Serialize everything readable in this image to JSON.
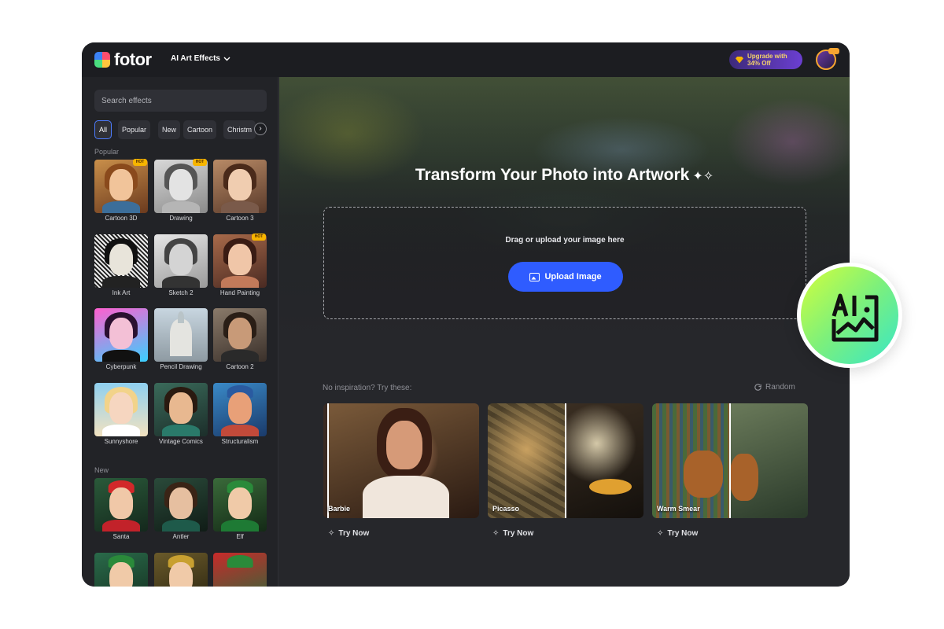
{
  "header": {
    "logo_text": "fotor",
    "menu_label": "AI Art Effects",
    "upgrade_label": "Upgrade with 34% Off"
  },
  "sidebar": {
    "search_placeholder": "Search effects",
    "filters": [
      "All",
      "Popular",
      "New",
      "Cartoon",
      "Christm"
    ],
    "popular_title": "Popular",
    "new_title": "New",
    "hot_label": "HOT",
    "popular_effects": [
      {
        "name": "Cartoon 3D",
        "hot": true
      },
      {
        "name": "Drawing",
        "hot": true
      },
      {
        "name": "Cartoon 3",
        "hot": false
      },
      {
        "name": "Ink Art",
        "hot": false
      },
      {
        "name": "Sketch 2",
        "hot": false
      },
      {
        "name": "Hand Painting",
        "hot": true
      },
      {
        "name": "Cyberpunk",
        "hot": false
      },
      {
        "name": "Pencil Drawing",
        "hot": false
      },
      {
        "name": "Cartoon 2",
        "hot": false
      },
      {
        "name": "Sunnyshore",
        "hot": false
      },
      {
        "name": "Vintage Comics",
        "hot": false
      },
      {
        "name": "Structuralism",
        "hot": false
      }
    ],
    "new_effects": [
      {
        "name": "Santa"
      },
      {
        "name": "Antler"
      },
      {
        "name": "Elf"
      }
    ]
  },
  "main": {
    "hero_title": "Transform Your Photo into Artwork",
    "drop_text": "Drag or upload your image here",
    "upload_label": "Upload Image",
    "inspiration_text": "No inspiration? Try these:",
    "random_label": "Random",
    "samples": [
      {
        "label": "Barbie",
        "action": "Try Now"
      },
      {
        "label": "Picasso",
        "action": "Try Now"
      },
      {
        "label": "Warm Smear",
        "action": "Try Now"
      }
    ]
  },
  "colors": {
    "accent": "#2f5cff",
    "hot_badge": "#f7b500",
    "background": "#26272b"
  }
}
